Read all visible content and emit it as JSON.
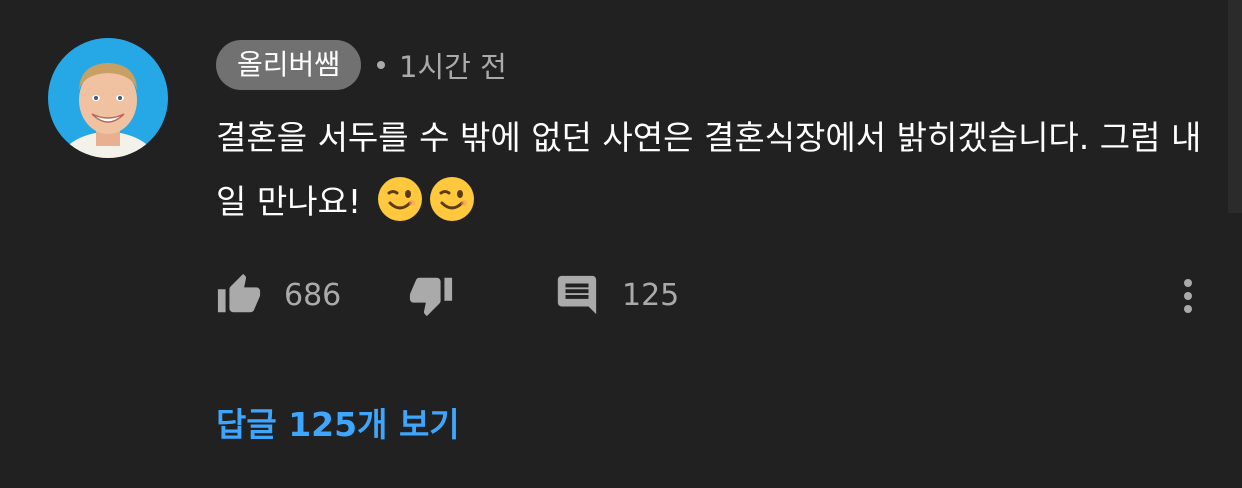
{
  "comment": {
    "author": "올리버쌤",
    "time": "1시간 전",
    "text": "결혼을 서두를 수 밖에 없던 사연은 결혼식장에서 밝히겠습니다. 그럼 내일 만나요!",
    "emojis": [
      "winking-face-icon",
      "winking-face-icon"
    ],
    "avatar_icon": "user-avatar-photo"
  },
  "actions": {
    "like_icon": "thumbs-up-icon",
    "like_count": "686",
    "dislike_icon": "thumbs-down-icon",
    "reply_icon": "comment-icon",
    "reply_count": "125",
    "more_icon": "more-vertical-icon"
  },
  "replies": {
    "view_label": "답글 125개 보기"
  },
  "colors": {
    "background": "#212121",
    "chip": "#717171",
    "secondary_text": "#aaaaaa",
    "link": "#3ea6ff",
    "avatar_ring": "#27a8e6"
  }
}
